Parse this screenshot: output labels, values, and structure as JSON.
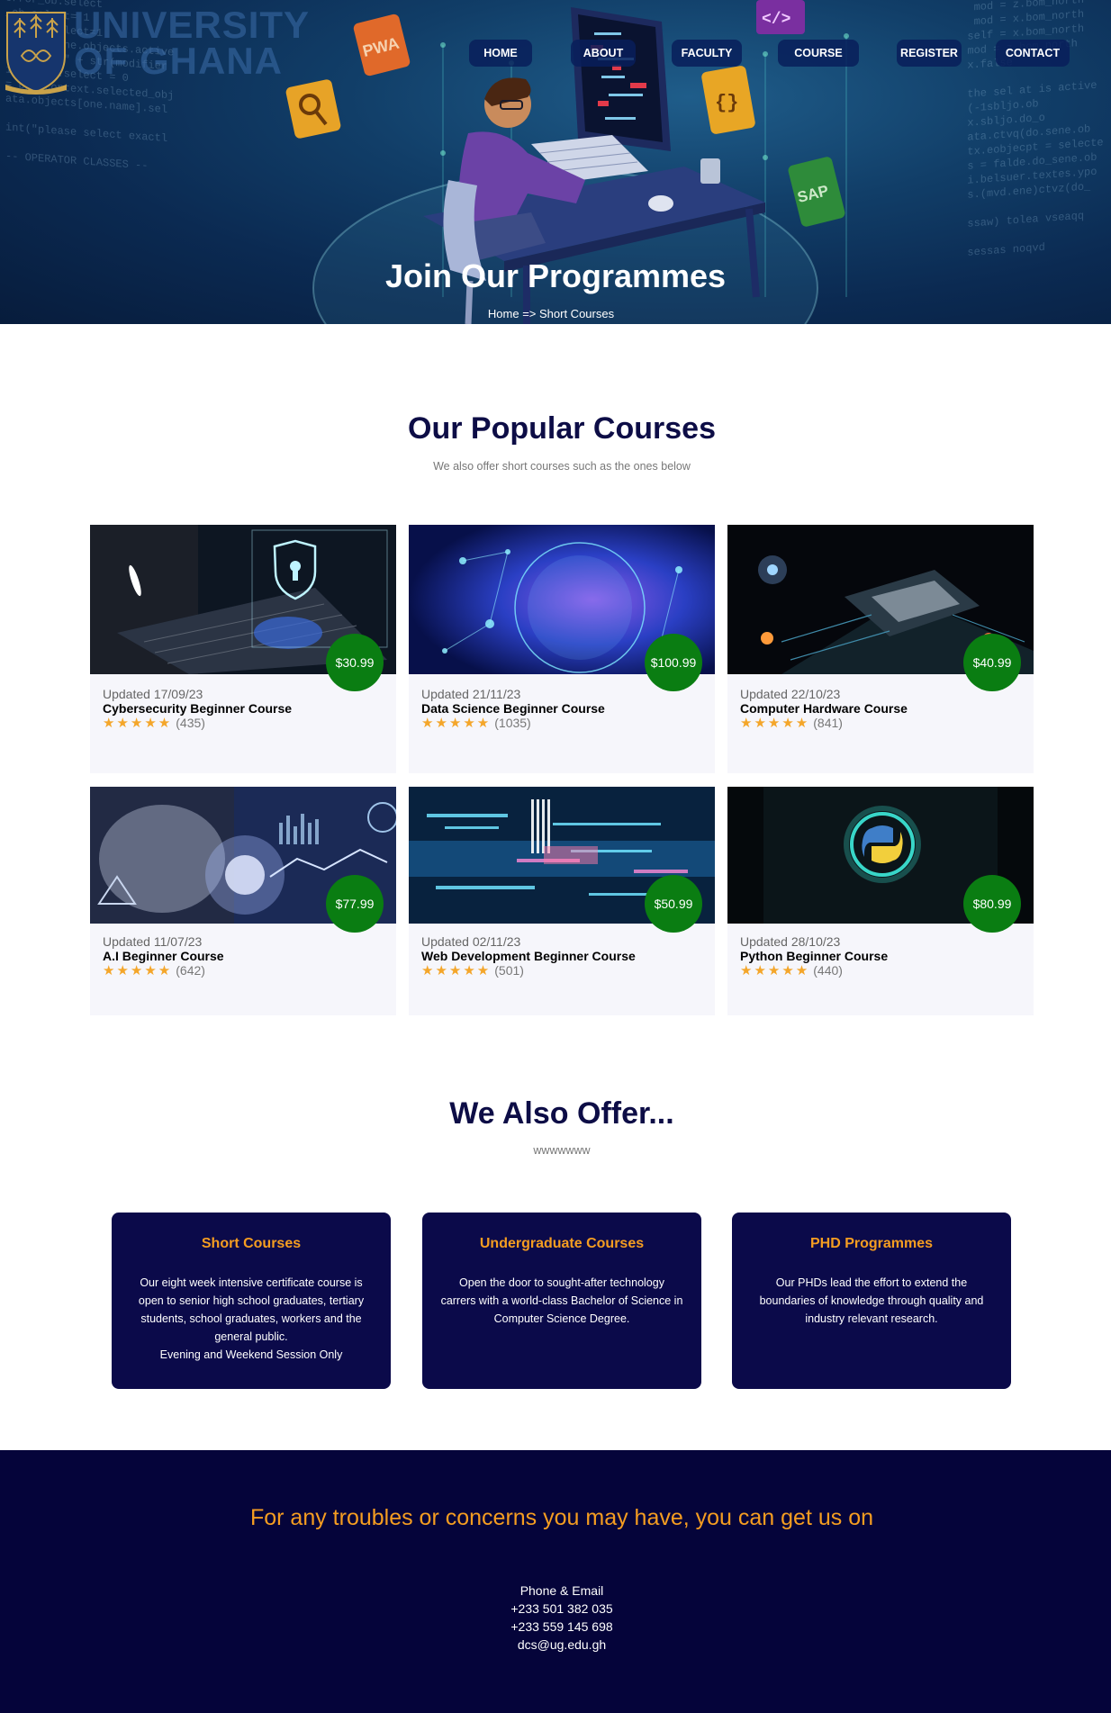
{
  "brand": {
    "line1": "UNIVERSITY",
    "line2": "OF GHANA"
  },
  "nav": [
    {
      "label": "HOME"
    },
    {
      "label": "ABOUT"
    },
    {
      "label": "FACULTY"
    },
    {
      "label": "COURSE"
    },
    {
      "label": "REGISTER"
    },
    {
      "label": "CONTACT"
    }
  ],
  "hero": {
    "title": "Join Our Programmes",
    "breadcrumb": "Home => Short Courses"
  },
  "popular": {
    "title": "Our Popular Courses",
    "subtitle": "We also offer short courses such as the ones below",
    "courses": [
      {
        "price": "$30.99",
        "updated": "Updated 17/09/23",
        "name": "Cybersecurity Beginner Course",
        "stars": "★★★★★",
        "reviews": "(435)"
      },
      {
        "price": "$100.99",
        "updated": "Updated 21/11/23",
        "name": "Data Science Beginner Course",
        "stars": "★★★★★",
        "reviews": "(1035)"
      },
      {
        "price": "$40.99",
        "updated": "Updated 22/10/23",
        "name": "Computer Hardware Course",
        "stars": "★★★★★",
        "reviews": "(841)"
      },
      {
        "price": "$77.99",
        "updated": "Updated 11/07/23",
        "name": "A.I Beginner Course",
        "stars": "★★★★★",
        "reviews": "(642)"
      },
      {
        "price": "$50.99",
        "updated": "Updated 02/11/23",
        "name": "Web Development Beginner Course",
        "stars": "★★★★★",
        "reviews": "(501)"
      },
      {
        "price": "$80.99",
        "updated": "Updated 28/10/23",
        "name": "Python Beginner Course",
        "stars": "★★★★★",
        "reviews": "(440)"
      }
    ]
  },
  "offer": {
    "title": "We Also Offer...",
    "subtitle": "wwwwwww",
    "cards": [
      {
        "title": "Short Courses",
        "text": "Our eight week intensive certificate course is open to senior high school graduates, tertiary students, school graduates, workers and the general public.\nEvening and Weekend Session Only"
      },
      {
        "title": "Undergraduate Courses",
        "text": "Open the door to sought-after technology carrers with a world-class Bachelor of Science in Computer Science Degree."
      },
      {
        "title": "PHD Programmes",
        "text": "Our PHDs lead the effort to extend the boundaries of knowledge through quality and industry relevant research."
      }
    ]
  },
  "footer": {
    "heading": "For any troubles or concerns you may have, you can get us on",
    "label": "Phone & Email",
    "phone1": "+233 501 382 035",
    "phone2": "+233 559 145 698",
    "email": "dcs@ug.edu.gh"
  },
  "hero_code": {
    "left": "error_ob.select\n_ob.select= 1\nror_ob.select=1\nntext.scene.objects.active\n\"Selected\" + str(modifier\nirror_ob.select = 0\n= bpy.context.selected_obj\nata.objects[one.name].sel\n\nint(\"please select exactl\n\n-- OPERATOR CLASSES --",
    "right": "   mod = z.bom_north\n   mod = x.bom_north\n  self = x.bom_north\n  mod = z.bom_north\n  x.false\n\n  the sel at is active\n  (-1sbljo.ob\n  x.sbljo.do_o\n  ata.ctvq(do.sene.ob\n  tx.eobjecpt = selecte\n  s = falde.do_sene.ob\n  i.belsuer.textes.ypo\n  s.(mvd.ene)ctvz(do_\n\n  ssaw) tolea vseaqq\n\n  sessas noqvd"
  },
  "colors": {
    "navy": "#0b0a4a",
    "footer_bg": "#05043a",
    "accent_orange": "#f59d21",
    "price_green": "#0a7d12",
    "star_gold": "#f4a62a",
    "heading_navy": "#0d0d46"
  }
}
